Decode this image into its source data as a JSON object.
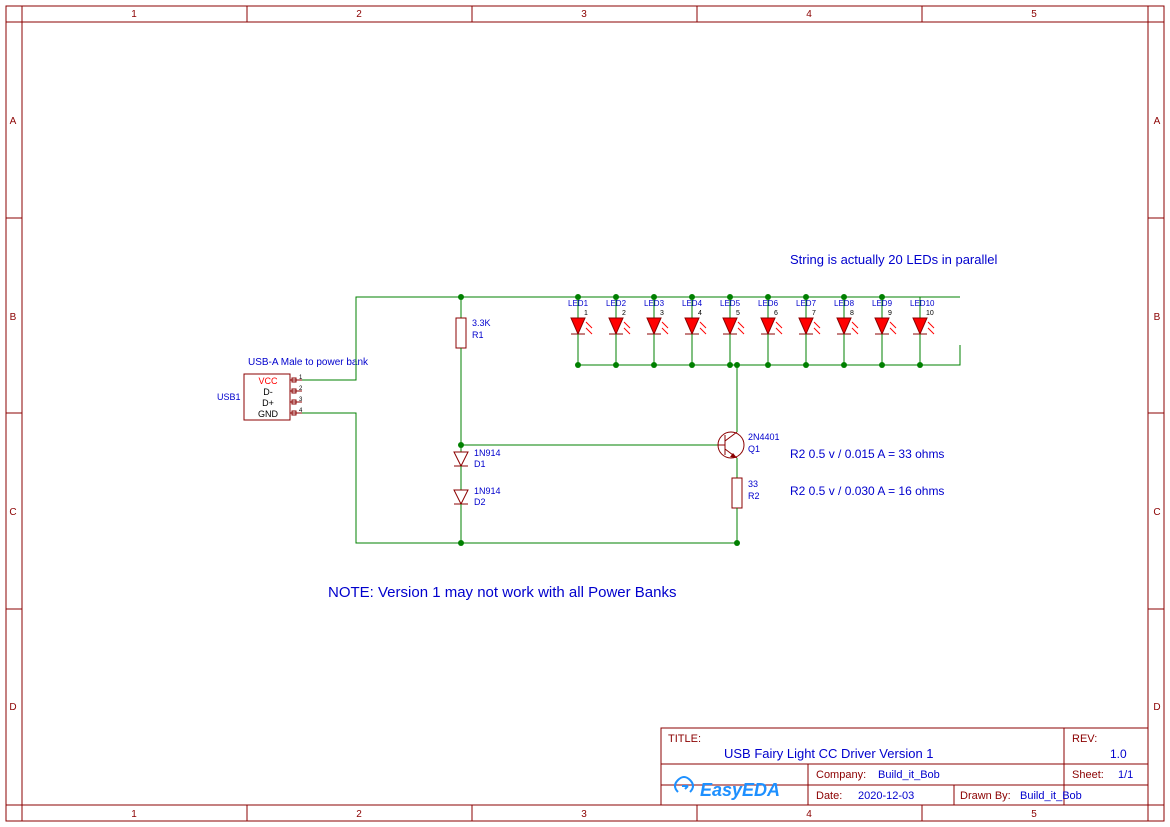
{
  "frame": {
    "cols": [
      "1",
      "2",
      "3",
      "4",
      "5"
    ],
    "rows": [
      "A",
      "B",
      "C",
      "D"
    ]
  },
  "titleblock": {
    "title_label": "TITLE:",
    "title": "USB Fairy Light CC Driver Version 1",
    "rev_label": "REV:",
    "rev": "1.0",
    "company_label": "Company:",
    "company": "Build_it_Bob",
    "sheet_label": "Sheet:",
    "sheet": "1/1",
    "date_label": "Date:",
    "date": "2020-12-03",
    "drawnby_label": "Drawn By:",
    "drawnby": "Build_it_Bob",
    "logo": "EasyEDA"
  },
  "notes": {
    "led_info": "String is actually 20 LEDs in parallel",
    "calc1": "R2 0.5 v / 0.015 A = 33 ohms",
    "calc2": "R2 0.5 v / 0.030 A = 16 ohms",
    "main_note": "NOTE: Version 1 may not work with all Power Banks"
  },
  "usb": {
    "ref": "USB1",
    "label": "USB-A Male to power bank",
    "pin1": "VCC",
    "pin2": "D-",
    "pin3": "D+",
    "pin4": "GND",
    "n1": "1",
    "n2": "2",
    "n3": "3",
    "n4": "4"
  },
  "r1": {
    "value": "3.3K",
    "ref": "R1"
  },
  "r2": {
    "value": "33",
    "ref": "R2"
  },
  "d1": {
    "value": "1N914",
    "ref": "D1"
  },
  "d2": {
    "value": "1N914",
    "ref": "D2"
  },
  "q1": {
    "value": "2N4401",
    "ref": "Q1"
  },
  "leds": [
    {
      "ref": "LED1",
      "pin": "1"
    },
    {
      "ref": "LED2",
      "pin": "2"
    },
    {
      "ref": "LED3",
      "pin": "3"
    },
    {
      "ref": "LED4",
      "pin": "4"
    },
    {
      "ref": "LED5",
      "pin": "5"
    },
    {
      "ref": "LED6",
      "pin": "6"
    },
    {
      "ref": "LED7",
      "pin": "7"
    },
    {
      "ref": "LED8",
      "pin": "8"
    },
    {
      "ref": "LED9",
      "pin": "9"
    },
    {
      "ref": "LED10",
      "pin": "10"
    }
  ]
}
